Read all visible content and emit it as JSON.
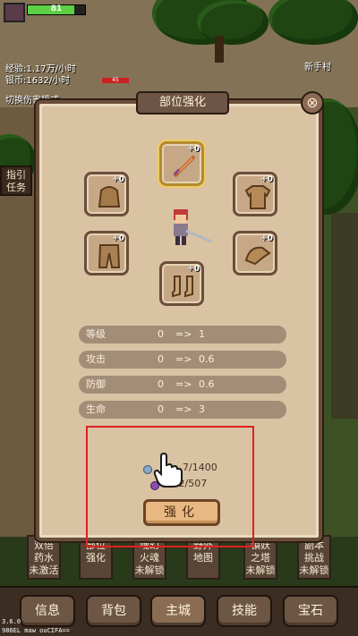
{
  "hud": {
    "hp_value": "81",
    "hp_fraction": 0.81,
    "exp_rate": "经验:1.17万/小时",
    "silver_rate": "银币:1632/小时",
    "toggle_damage": "切换伤害模式",
    "zone_name": "新手村",
    "enemy_hp": "45"
  },
  "side": {
    "guide_task": "指引\n任务"
  },
  "modal": {
    "title": "部位强化",
    "close_label": "⊗",
    "slots": [
      {
        "name": "weapon",
        "plus": "+0",
        "selected": true
      },
      {
        "name": "helmet",
        "plus": "+0"
      },
      {
        "name": "armor",
        "plus": "+0"
      },
      {
        "name": "pants",
        "plus": "+0"
      },
      {
        "name": "gloves",
        "plus": "+0"
      },
      {
        "name": "boots",
        "plus": "+0"
      }
    ],
    "stats": [
      {
        "name": "等级",
        "from": "0",
        "arrow": "=>",
        "to": "1"
      },
      {
        "name": "攻击",
        "from": "0",
        "arrow": "=>",
        "to": "0.6"
      },
      {
        "name": "防御",
        "from": "0",
        "arrow": "=>",
        "to": "0.6"
      },
      {
        "name": "生命",
        "from": "0",
        "arrow": "=>",
        "to": "3"
      }
    ],
    "cost_1": "7/1400",
    "cost_2": "30 2/507",
    "strengthen_label": "强化"
  },
  "features": [
    {
      "label": "双倍\n药水\n未激活"
    },
    {
      "label": "部位\n强化"
    },
    {
      "label": "魂幻\n火魂\n未解锁"
    },
    {
      "label": "野外\n地图"
    },
    {
      "label": "镇妖\n之塔\n未解锁"
    },
    {
      "label": "副本\n挑战\n未解锁"
    }
  ],
  "nav": {
    "info": "信息",
    "bag": "背包",
    "city": "主城",
    "skill": "技能",
    "gem": "宝石"
  },
  "footer": {
    "version": "3.6.0",
    "device": "986EL maw  ouCIFA=="
  }
}
